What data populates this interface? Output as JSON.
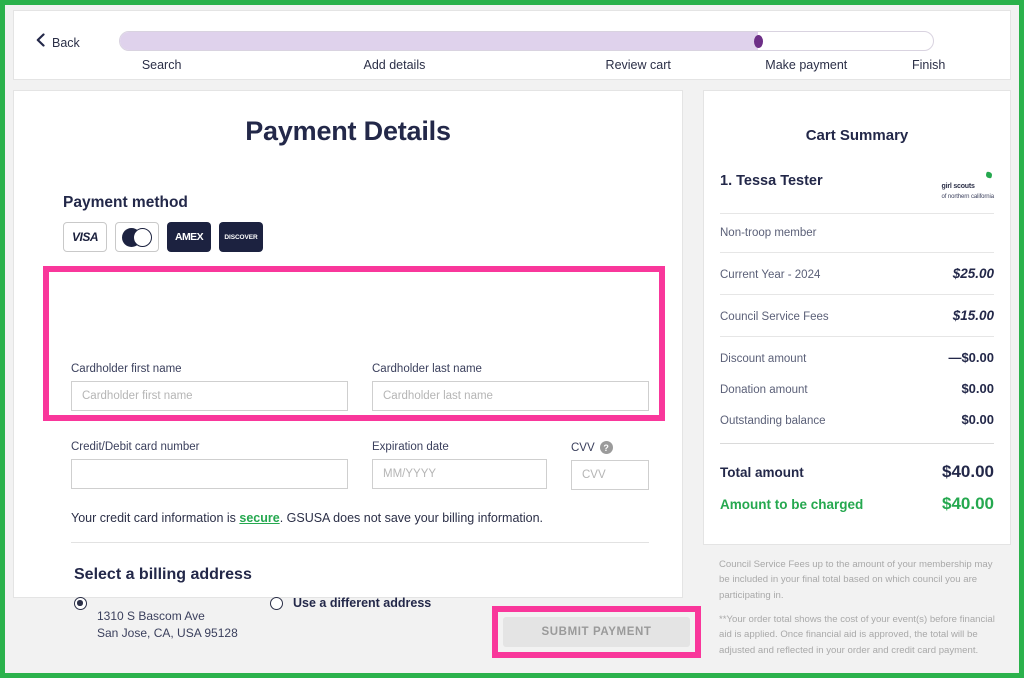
{
  "theme": {
    "frame_green": "#2bb24c",
    "accent_pink": "#f9379b",
    "brand_green": "#25a84f",
    "navy": "#232849",
    "progress_purple": "#6d2f87",
    "progress_fill": "#dfd2ec"
  },
  "header": {
    "back_label": "Back",
    "back_icon": "chevron-left-icon",
    "progress_percent": 78.5,
    "steps": [
      {
        "label": "Search",
        "left_pct": 2.8
      },
      {
        "label": "Add details",
        "left_pct": 30.0
      },
      {
        "label": "Review cart",
        "left_pct": 59.7
      },
      {
        "label": "Make payment",
        "left_pct": 79.3
      },
      {
        "label": "Finish",
        "left_pct": 97.3
      }
    ]
  },
  "main": {
    "title": "Payment Details",
    "payment_method_title": "Payment method",
    "card_brands": [
      {
        "name": "VISA",
        "icon": "visa-card-icon",
        "style": "light"
      },
      {
        "name": "",
        "icon": "mastercard-card-icon",
        "style": "light"
      },
      {
        "name": "AMEX",
        "icon": "amex-card-icon",
        "style": "dark"
      },
      {
        "name": "DISCOVER",
        "icon": "discover-card-icon",
        "style": "dark"
      }
    ],
    "fields": {
      "first_name": {
        "label": "Cardholder first name",
        "placeholder": "Cardholder first name",
        "value": ""
      },
      "last_name": {
        "label": "Cardholder last name",
        "placeholder": "Cardholder last name",
        "value": ""
      },
      "card_number": {
        "label": "Credit/Debit card number",
        "placeholder": "",
        "value": ""
      },
      "expiration": {
        "label": "Expiration date",
        "placeholder": "MM/YYYY",
        "value": ""
      },
      "cvv": {
        "label": "CVV",
        "placeholder": "CVV",
        "value": "",
        "help_icon": "question-mark-icon"
      }
    },
    "secure_note": {
      "before": "Your credit card information is ",
      "link": "secure",
      "after": ". GSUSA does not save your billing information."
    },
    "billing": {
      "title": "Select a billing address",
      "saved": {
        "selected": true,
        "line1": "1310 S Bascom Ave",
        "line2": "San Jose, CA, USA 95128"
      },
      "different": {
        "selected": false,
        "label": "Use a different address"
      }
    },
    "submit_label": "SUBMIT PAYMENT",
    "submit_disabled": true
  },
  "cart": {
    "title": "Cart Summary",
    "attendee": "1. Tessa Tester",
    "logo": {
      "main": "girl scouts",
      "sub": "of northern california",
      "icon": "girl-scouts-trefoil-icon"
    },
    "membership_type": "Non-troop member",
    "line_items": [
      {
        "key": "Current Year - 2024",
        "value": "$25.00"
      },
      {
        "key": "Council Service Fees",
        "value": "$15.00"
      }
    ],
    "adjustments": [
      {
        "key": "Discount amount",
        "value": "—$0.00"
      },
      {
        "key": "Donation amount",
        "value": "$0.00"
      },
      {
        "key": "Outstanding balance",
        "value": "$0.00"
      }
    ],
    "total": {
      "key": "Total amount",
      "value": "$40.00"
    },
    "charged": {
      "key": "Amount to be charged",
      "value": "$40.00"
    },
    "footnotes": [
      "Council Service Fees up to the amount of your membership may be included in your final total based on which council you are participating in.",
      "**Your order total shows the cost of your event(s) before financial aid is applied. Once financial aid is approved, the total will be adjusted and reflected in your order and credit card payment."
    ]
  }
}
